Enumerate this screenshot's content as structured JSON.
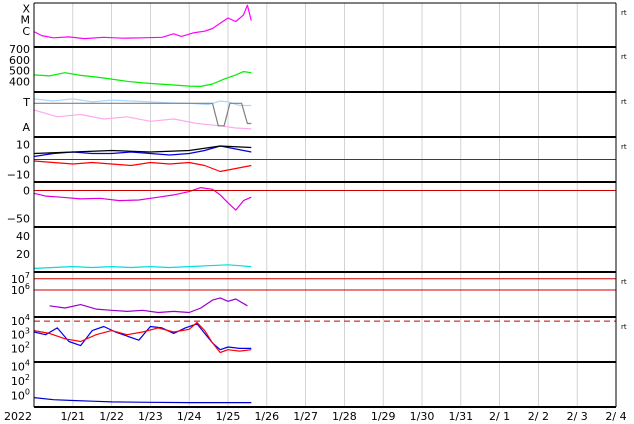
{
  "chart_data": [
    {
      "type": "line",
      "panel_labels": [
        "X",
        "M",
        "C"
      ],
      "right_label": "rt",
      "series": [
        {
          "color": "#ff00ff",
          "values": [
            [
              20.0,
              3.5
            ],
            [
              20.2,
              2.6
            ],
            [
              20.5,
              2.1
            ],
            [
              20.9,
              2.3
            ],
            [
              21.3,
              1.9
            ],
            [
              21.8,
              2.2
            ],
            [
              22.3,
              2.0
            ],
            [
              22.8,
              2.1
            ],
            [
              23.3,
              2.2
            ],
            [
              23.6,
              3.0
            ],
            [
              23.8,
              2.4
            ],
            [
              24.1,
              3.2
            ],
            [
              24.4,
              3.6
            ],
            [
              24.6,
              4.2
            ],
            [
              24.8,
              5.4
            ],
            [
              25.0,
              6.6
            ],
            [
              25.2,
              5.8
            ],
            [
              25.4,
              7.3
            ],
            [
              25.5,
              9.5
            ],
            [
              25.6,
              6.0
            ]
          ]
        }
      ]
    },
    {
      "type": "line",
      "tick_labels": [
        "700",
        "600",
        "500",
        "400"
      ],
      "right_label": "rt",
      "series": [
        {
          "color": "#00ee00",
          "values": [
            [
              20.0,
              460
            ],
            [
              20.4,
              450
            ],
            [
              20.8,
              480
            ],
            [
              21.2,
              455
            ],
            [
              21.6,
              440
            ],
            [
              22.0,
              420
            ],
            [
              22.4,
              400
            ],
            [
              22.8,
              385
            ],
            [
              23.2,
              375
            ],
            [
              23.6,
              365
            ],
            [
              24.0,
              355
            ],
            [
              24.3,
              352
            ],
            [
              24.6,
              375
            ],
            [
              24.9,
              420
            ],
            [
              25.2,
              460
            ],
            [
              25.4,
              490
            ],
            [
              25.6,
              480
            ]
          ]
        }
      ]
    },
    {
      "type": "line",
      "tick_labels": [
        "T",
        "A"
      ],
      "right_label": "rt",
      "series": [
        {
          "color": "#aad8ff",
          "values": [
            [
              20.0,
              0.85
            ],
            [
              20.5,
              0.8
            ],
            [
              21.0,
              0.85
            ],
            [
              21.5,
              0.78
            ],
            [
              22.0,
              0.82
            ],
            [
              22.5,
              0.8
            ],
            [
              23.0,
              0.78
            ],
            [
              23.5,
              0.76
            ],
            [
              24.0,
              0.75
            ],
            [
              24.5,
              0.72
            ],
            [
              24.8,
              0.8
            ],
            [
              25.0,
              0.78
            ],
            [
              25.3,
              0.7
            ],
            [
              25.6,
              0.7
            ]
          ]
        },
        {
          "color": "#ffaaee",
          "values": [
            [
              20.0,
              0.6
            ],
            [
              20.6,
              0.45
            ],
            [
              21.2,
              0.5
            ],
            [
              21.8,
              0.4
            ],
            [
              22.4,
              0.45
            ],
            [
              23.0,
              0.35
            ],
            [
              23.6,
              0.4
            ],
            [
              24.2,
              0.3
            ],
            [
              24.8,
              0.25
            ],
            [
              25.2,
              0.2
            ],
            [
              25.6,
              0.18
            ]
          ]
        },
        {
          "color": "#808080",
          "values": [
            [
              20.0,
              0.75
            ],
            [
              24.6,
              0.75
            ],
            [
              24.75,
              0.25
            ],
            [
              24.9,
              0.25
            ],
            [
              25.05,
              0.75
            ],
            [
              25.35,
              0.75
            ],
            [
              25.5,
              0.3
            ],
            [
              25.6,
              0.3
            ]
          ]
        }
      ]
    },
    {
      "type": "line",
      "tick_labels": [
        "10",
        "0",
        "−10"
      ],
      "right_label": "rt",
      "series": [
        {
          "color": "#0000dd",
          "values": [
            [
              20.0,
              2
            ],
            [
              20.5,
              4
            ],
            [
              21.0,
              5
            ],
            [
              21.5,
              4
            ],
            [
              22.0,
              4
            ],
            [
              22.5,
              5
            ],
            [
              23.0,
              4
            ],
            [
              23.5,
              3
            ],
            [
              24.0,
              4
            ],
            [
              24.4,
              6
            ],
            [
              24.8,
              9
            ],
            [
              25.2,
              7
            ],
            [
              25.6,
              5
            ]
          ]
        },
        {
          "color": "#ff0000",
          "values": [
            [
              20.0,
              -1
            ],
            [
              20.5,
              -2
            ],
            [
              21.0,
              -3
            ],
            [
              21.5,
              -2
            ],
            [
              22.0,
              -3
            ],
            [
              22.5,
              -4
            ],
            [
              23.0,
              -2
            ],
            [
              23.5,
              -3
            ],
            [
              24.0,
              -2
            ],
            [
              24.4,
              -4
            ],
            [
              24.8,
              -8
            ],
            [
              25.2,
              -6
            ],
            [
              25.6,
              -4
            ]
          ]
        },
        {
          "color": "#000000",
          "values": [
            [
              20.0,
              4
            ],
            [
              21.0,
              5
            ],
            [
              22.0,
              6
            ],
            [
              23.0,
              5
            ],
            [
              24.0,
              6
            ],
            [
              24.8,
              9
            ],
            [
              25.6,
              8
            ]
          ]
        }
      ]
    },
    {
      "type": "line",
      "tick_labels": [
        "0",
        "−50"
      ],
      "series": [
        {
          "color": "#dd00dd",
          "values": [
            [
              20.0,
              -5
            ],
            [
              20.3,
              -10
            ],
            [
              20.7,
              -12
            ],
            [
              21.2,
              -15
            ],
            [
              21.7,
              -14
            ],
            [
              22.2,
              -18
            ],
            [
              22.7,
              -17
            ],
            [
              23.2,
              -12
            ],
            [
              23.6,
              -8
            ],
            [
              24.0,
              -2
            ],
            [
              24.3,
              5
            ],
            [
              24.6,
              2
            ],
            [
              24.8,
              -8
            ],
            [
              25.0,
              -22
            ],
            [
              25.2,
              -35
            ],
            [
              25.4,
              -18
            ],
            [
              25.6,
              -12
            ]
          ]
        }
      ]
    },
    {
      "type": "line",
      "tick_labels": [
        "40",
        "20"
      ],
      "series": [
        {
          "color": "#00dddd",
          "values": [
            [
              20.0,
              4
            ],
            [
              20.5,
              5
            ],
            [
              21.0,
              6
            ],
            [
              21.5,
              5
            ],
            [
              22.0,
              6
            ],
            [
              22.5,
              5
            ],
            [
              23.0,
              6
            ],
            [
              23.5,
              5
            ],
            [
              24.0,
              6
            ],
            [
              24.5,
              7
            ],
            [
              25.0,
              8
            ],
            [
              25.3,
              7
            ],
            [
              25.6,
              6
            ]
          ]
        }
      ]
    },
    {
      "type": "line",
      "tick_labels": [
        "10^7",
        "10^6"
      ],
      "right_label": "rt",
      "series": [
        {
          "color": "#9900cc",
          "values": [
            [
              20.4,
              4.6
            ],
            [
              20.8,
              4.4
            ],
            [
              21.2,
              4.7
            ],
            [
              21.6,
              4.3
            ],
            [
              22.0,
              4.2
            ],
            [
              22.4,
              4.1
            ],
            [
              22.8,
              4.2
            ],
            [
              23.2,
              4.0
            ],
            [
              23.6,
              4.1
            ],
            [
              24.0,
              4.0
            ],
            [
              24.3,
              4.4
            ],
            [
              24.6,
              5.1
            ],
            [
              24.8,
              5.3
            ],
            [
              25.0,
              5.0
            ],
            [
              25.2,
              5.2
            ],
            [
              25.5,
              4.6
            ]
          ]
        }
      ]
    },
    {
      "type": "line",
      "tick_labels": [
        "10^4",
        "10^3",
        "10^2"
      ],
      "right_label": "rt",
      "series": [
        {
          "color": "#0000ee",
          "values": [
            [
              20.0,
              3.2
            ],
            [
              20.3,
              3.0
            ],
            [
              20.6,
              3.5
            ],
            [
              20.9,
              2.5
            ],
            [
              21.2,
              2.2
            ],
            [
              21.5,
              3.3
            ],
            [
              21.8,
              3.6
            ],
            [
              22.1,
              3.2
            ],
            [
              22.4,
              2.9
            ],
            [
              22.7,
              2.6
            ],
            [
              23.0,
              3.6
            ],
            [
              23.3,
              3.5
            ],
            [
              23.6,
              3.1
            ],
            [
              23.9,
              3.5
            ],
            [
              24.2,
              3.8
            ],
            [
              24.4,
              3.1
            ],
            [
              24.6,
              2.4
            ],
            [
              24.8,
              1.9
            ],
            [
              25.0,
              2.1
            ],
            [
              25.3,
              2.0
            ],
            [
              25.6,
              2.0
            ]
          ]
        },
        {
          "color": "#ff0000",
          "values": [
            [
              20.0,
              3.3
            ],
            [
              20.4,
              3.1
            ],
            [
              20.8,
              2.7
            ],
            [
              21.2,
              2.5
            ],
            [
              21.6,
              3.0
            ],
            [
              22.0,
              3.3
            ],
            [
              22.4,
              3.0
            ],
            [
              22.8,
              3.2
            ],
            [
              23.2,
              3.5
            ],
            [
              23.6,
              3.2
            ],
            [
              24.0,
              3.4
            ],
            [
              24.2,
              3.9
            ],
            [
              24.4,
              3.3
            ],
            [
              24.6,
              2.4
            ],
            [
              24.8,
              1.7
            ],
            [
              25.0,
              1.9
            ],
            [
              25.3,
              1.8
            ],
            [
              25.6,
              1.9
            ]
          ]
        }
      ]
    },
    {
      "type": "line",
      "tick_labels": [
        "10^4",
        "10^2",
        "10^0"
      ],
      "series": [
        {
          "color": "#0000cc",
          "values": [
            [
              20.0,
              -0.3
            ],
            [
              20.5,
              -0.6
            ],
            [
              21.0,
              -0.7
            ],
            [
              21.5,
              -0.8
            ],
            [
              22.0,
              -0.9
            ],
            [
              23.0,
              -0.95
            ],
            [
              24.0,
              -1.0
            ],
            [
              25.0,
              -1.0
            ],
            [
              25.6,
              -1.0
            ]
          ]
        }
      ]
    }
  ],
  "x_axis": {
    "year_label": "2022",
    "tick_labels": [
      "1/21",
      "1/22",
      "1/23",
      "1/24",
      "1/25",
      "1/26",
      "1/27",
      "1/28",
      "1/29",
      "1/30",
      "1/31",
      "2/ 1",
      "2/ 2",
      "2/ 3",
      "2/ 4"
    ]
  }
}
